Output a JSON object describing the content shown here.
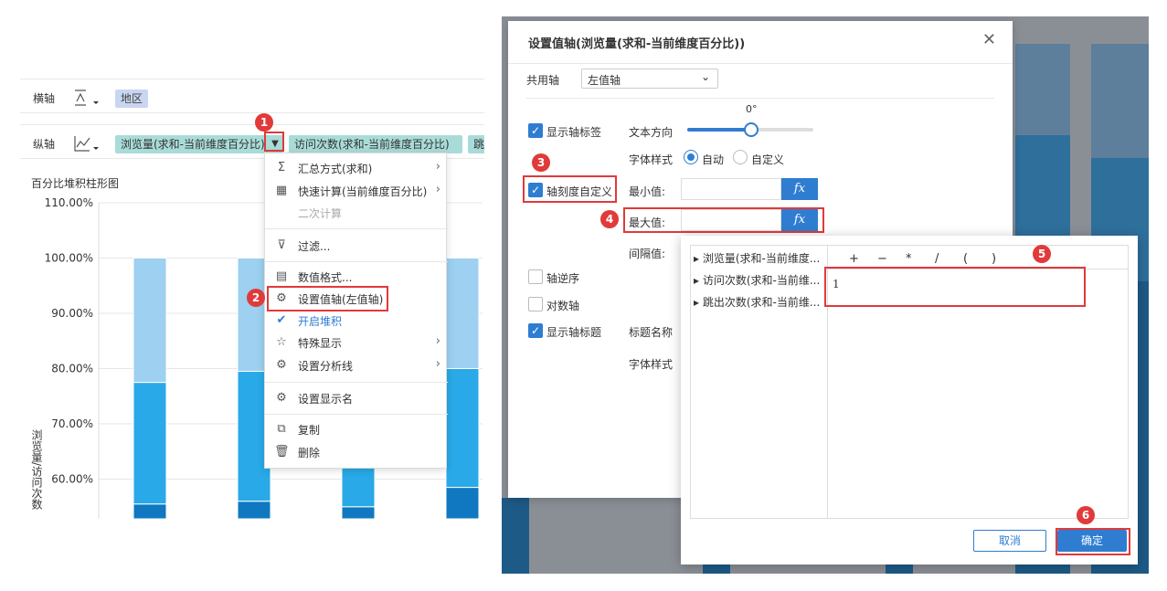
{
  "left": {
    "x_axis_label": "横轴",
    "x_pill": "地区",
    "y_axis_label": "纵轴",
    "y_pills": [
      "浏览量(求和-当前维度百分比)",
      "访问次数(求和-当前维度百分比)",
      "跳"
    ],
    "chart_title": "百分比堆积柱形图",
    "y_ticks": [
      "110.00%",
      "100.00%",
      "90.00%",
      "80.00%",
      "70.00%",
      "60.00%"
    ],
    "y_axis_title": "浏览量/访问次数"
  },
  "chart_data": {
    "type": "bar",
    "stacked": true,
    "title": "百分比堆积柱形图",
    "ylabel": "浏览量/访问次数",
    "ylim": [
      55,
      110
    ],
    "series": [
      {
        "name": "",
        "color": "#0f78c0",
        "values": [
          55.5,
          56,
          55,
          58.5
        ]
      },
      {
        "name": "",
        "color": "#29a9e8",
        "values": [
          77.5,
          79.5,
          76,
          80
        ]
      },
      {
        "name": "",
        "color": "#9dd0f1",
        "values": [
          100,
          100,
          100,
          100
        ]
      }
    ]
  },
  "menu": {
    "items": [
      {
        "label": "汇总方式(求和)",
        "icon": "sigma-icon",
        "arrow": true
      },
      {
        "label": "快速计算(当前维度百分比)",
        "icon": "calc-icon",
        "arrow": true
      },
      {
        "label": "二次计算",
        "icon": "",
        "disabled": true
      },
      {
        "label": "过滤...",
        "icon": "filter-icon"
      },
      {
        "label": "数值格式...",
        "icon": "format-icon"
      },
      {
        "label": "设置值轴(左值轴)",
        "icon": "gear-icon"
      },
      {
        "label": "开启堆积",
        "icon": "check-icon",
        "checked": true
      },
      {
        "label": "特殊显示",
        "icon": "star-icon",
        "arrow": true
      },
      {
        "label": "设置分析线",
        "icon": "gear-icon",
        "arrow": true
      },
      {
        "label": "设置显示名",
        "icon": "gear-icon"
      },
      {
        "label": "复制",
        "icon": "copy-icon"
      },
      {
        "label": "删除",
        "icon": "trash-icon"
      }
    ]
  },
  "steps": [
    "1",
    "2",
    "3",
    "4",
    "5",
    "6"
  ],
  "dialog": {
    "title": "设置值轴(浏览量(求和-当前维度百分比))",
    "shared_axis_label": "共用轴",
    "shared_axis_value": "左值轴",
    "show_axis_label": "显示轴标签",
    "text_direction_label": "文本方向",
    "text_direction_value": "0°",
    "font_style_label": "字体样式",
    "font_auto": "自动",
    "font_custom": "自定义",
    "custom_scale_label": "轴刻度自定义",
    "min_label": "最小值:",
    "max_label": "最大值:",
    "interval_label": "间隔值:",
    "reverse_label": "轴逆序",
    "log_label": "对数轴",
    "show_title_label": "显示轴标题",
    "title_name_label": "标题名称",
    "font_style_label2": "字体样式",
    "fx": "fx"
  },
  "formula": {
    "fields": [
      "浏览量(求和-当前维度...",
      "访问次数(求和-当前维...",
      "跳出次数(求和-当前维..."
    ],
    "operators": [
      "+",
      "−",
      "*",
      "/",
      "(",
      ")"
    ],
    "value": "1",
    "cancel": "取消",
    "ok": "确定"
  }
}
